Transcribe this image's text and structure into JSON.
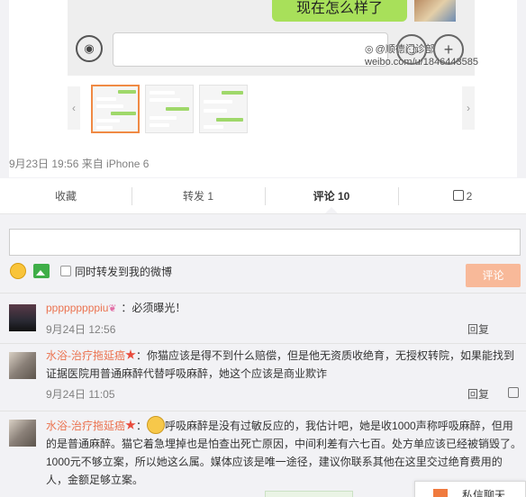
{
  "image": {
    "bubble_text": "现在怎么样了",
    "watermark_handle": "@顺德门诊部",
    "watermark_url": "weibo.com/u/1846443585"
  },
  "post_meta": {
    "time_source": "9月23日 19:56 来自 iPhone 6"
  },
  "actions": {
    "favorite": "收藏",
    "repost": "转发 1",
    "comment": "评论 10",
    "like_count": "2"
  },
  "composer": {
    "placeholder": "",
    "repost_label": "同时转发到我的微博",
    "submit_label": "评论"
  },
  "comments": [
    {
      "name": "pppppppppiu",
      "text": "：必须曝光！",
      "time": "9月24日 12:56",
      "reply": "回复"
    },
    {
      "name": "水浴-治疗拖延癌",
      "text": "：你猫应该是得不到什么赔偿，但是他无资质收绝育，无授权转院，如果能找到证据医院用普通麻醉代替呼吸麻醉，她这个应该是商业欺诈",
      "time": "9月24日 11:05",
      "reply": "回复"
    },
    {
      "name": "水浴-治疗拖延癌",
      "text": "呼吸麻醉是没有过敏反应的，我估计吧，她是收1000声称呼吸麻醉，但用的是普通麻醉。猫它着急埋掉也是怕查出死亡原因，中间利差有六七百。处方单应该已经被销毁了。1000元不够立案，所以她这么属。媒体应该是唯一途径，建议你联系其他在这里交过绝育费用的人，金额足够立案。"
    }
  ],
  "float": {
    "private_chat": "私信聊天"
  },
  "colors": {
    "accent": "#eb7350",
    "submit_bg": "#f8b999",
    "page_bg": "#f2f2f5"
  }
}
